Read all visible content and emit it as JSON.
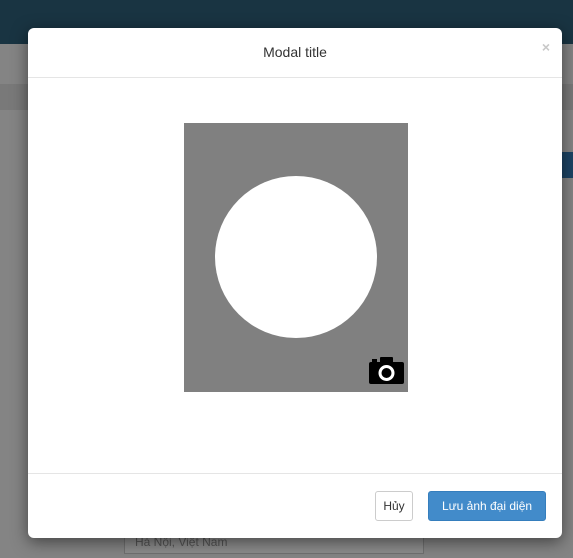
{
  "background": {
    "field_value": "Hà Nội, Việt Nam"
  },
  "modal": {
    "title": "Modal title",
    "close_symbol": "×",
    "avatar": {
      "frame_color": "#808080",
      "icon": "camera-icon"
    },
    "footer": {
      "cancel_label": "Hủy",
      "save_label": "Lưu ảnh đại diện"
    }
  },
  "colors": {
    "topbar": "#2e5f78",
    "primary": "#428bca"
  }
}
